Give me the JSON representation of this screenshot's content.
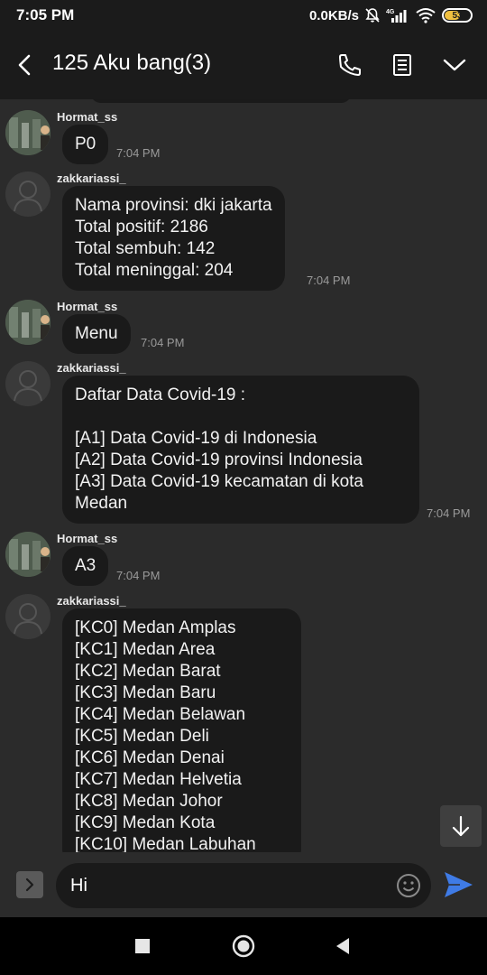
{
  "status_bar": {
    "time": "7:05 PM",
    "net_speed": "0.0KB/s",
    "battery_level": "53",
    "icons": [
      "mute-icon",
      "signal-4g-icon",
      "wifi-icon",
      "battery-icon"
    ]
  },
  "header": {
    "title": "125 Aku bang(3)",
    "icons": [
      "back-arrow-icon",
      "phone-icon",
      "notes-icon",
      "chevron-down-icon"
    ]
  },
  "messages": [
    {
      "sender": "Hormat_ss",
      "avatar": "photo",
      "text": "P0",
      "time": "7:04 PM"
    },
    {
      "sender": "zakkariassi_",
      "avatar": "default",
      "text": "Nama provinsi: dki jakarta\nTotal positif: 2186\nTotal sembuh: 142\nTotal meninggal: 204",
      "time": "7:04 PM"
    },
    {
      "sender": "Hormat_ss",
      "avatar": "photo",
      "text": "Menu",
      "time": "7:04 PM"
    },
    {
      "sender": "zakkariassi_",
      "avatar": "default",
      "text": "Daftar Data Covid-19 :\n\n[A1] Data Covid-19 di Indonesia\n[A2] Data Covid-19 provinsi Indonesia\n[A3] Data Covid-19 kecamatan di kota Medan",
      "time": "7:04 PM"
    },
    {
      "sender": "Hormat_ss",
      "avatar": "photo",
      "text": "A3",
      "time": "7:04 PM"
    },
    {
      "sender": "zakkariassi_",
      "avatar": "default",
      "text": "[KC0] Medan Amplas\n[KC1] Medan Area\n[KC2] Medan Barat\n[KC3] Medan Baru\n[KC4] Medan Belawan\n[KC5] Medan Deli\n[KC6] Medan Denai\n[KC7] Medan Helvetia\n[KC8] Medan Johor\n[KC9] Medan Kota\n[KC10] Medan Labuhan",
      "time": ""
    }
  ],
  "composer": {
    "input_value": "Hi",
    "icons": [
      "expand-icon",
      "emoji-icon",
      "send-icon"
    ]
  },
  "colors": {
    "background": "#2b2b2b",
    "bar": "#1b1b1b",
    "bubble": "#1a1a1a",
    "send_accent": "#3f7be6",
    "battery": "#f0c040"
  }
}
